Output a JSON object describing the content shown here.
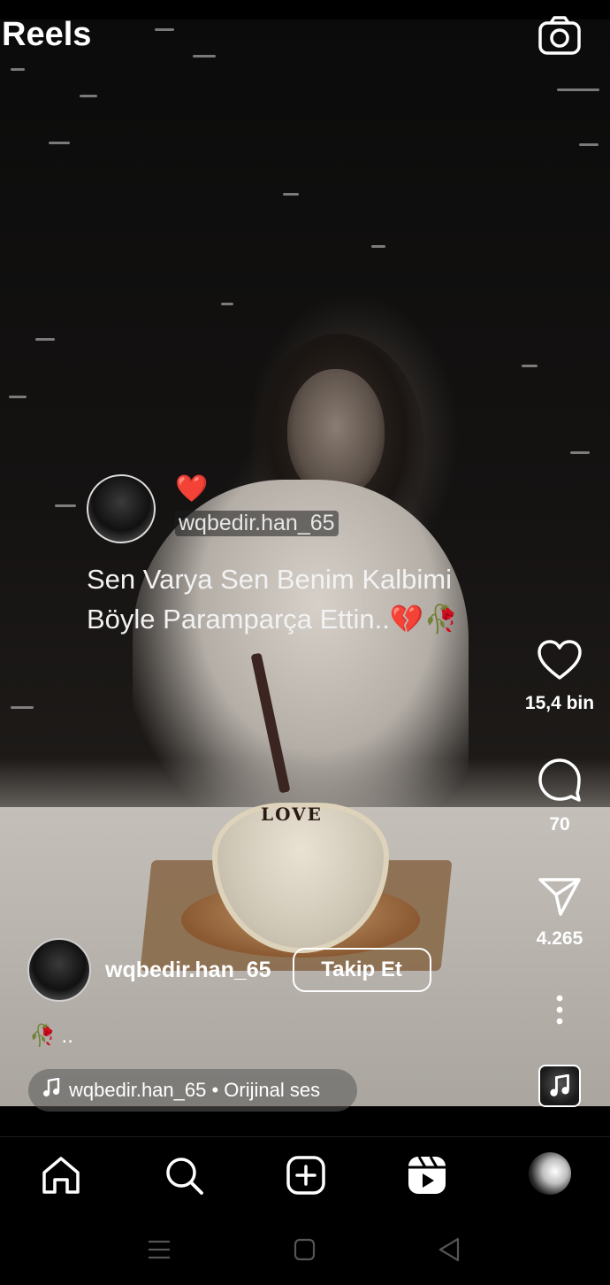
{
  "header": {
    "title": "Reels",
    "camera_icon": "camera-icon"
  },
  "video_overlay": {
    "username": "wqbedir.han_65",
    "heart_emoji": "❤️",
    "caption_line1": "Sen Varya Sen Benim Kalbimi",
    "caption_line2": "Böyle Paramparça Ettin..💔🥀",
    "cake_text": "LOVE"
  },
  "actions": {
    "likes": "15,4 bin",
    "comments": "70",
    "shares": "4.265",
    "like_icon": "heart-icon",
    "comment_icon": "comment-icon",
    "share_icon": "send-icon",
    "more_icon": "more-vertical-icon"
  },
  "post": {
    "username": "wqbedir.han_65",
    "follow_label": "Takip Et",
    "caption": "🥀 ..",
    "audio": "wqbedir.han_65 • Orijinal ses"
  },
  "nav": {
    "items": [
      "home-icon",
      "search-icon",
      "create-icon",
      "reels-icon",
      "profile-avatar"
    ]
  },
  "system_nav": [
    "recents-icon",
    "home-square-icon",
    "back-icon"
  ]
}
